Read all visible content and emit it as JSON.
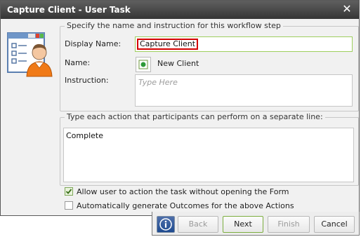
{
  "window": {
    "title": "Capture Client - User Task",
    "close_glyph": "✕"
  },
  "step_group": {
    "legend": "Specify the name and instruction for this workflow step",
    "display_name_label": "Display Name:",
    "display_name_value": "Capture Client",
    "name_label": "Name:",
    "name_value": "New Client",
    "instruction_label": "Instruction:",
    "instruction_placeholder": "Type Here"
  },
  "actions_group": {
    "legend": "Type each action that participants can perform on a separate line:",
    "actions_value": "Complete"
  },
  "options": [
    {
      "label": "Allow user to action the task without opening the Form",
      "checked": true
    },
    {
      "label": "Automatically generate Outcomes for the above Actions",
      "checked": false
    }
  ],
  "buttons": {
    "back": "Back",
    "next": "Next",
    "finish": "Finish",
    "cancel": "Cancel"
  },
  "colors": {
    "accent_green": "#9fcf5e",
    "highlight_red": "#d40000",
    "titlebar": "#444444"
  },
  "icons": {
    "header": "user-task-icon",
    "name": "workflow-step-icon",
    "info": "info-icon",
    "close": "close-icon"
  }
}
